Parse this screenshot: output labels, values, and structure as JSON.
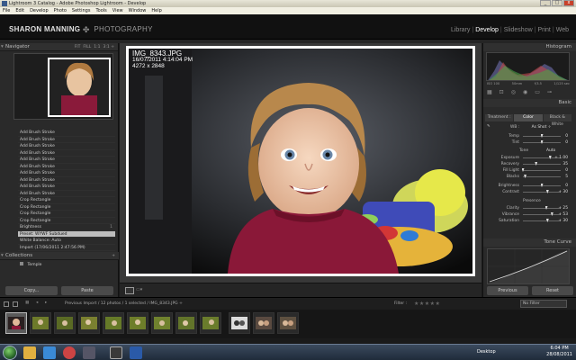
{
  "window": {
    "title": "Lightroom 3 Catalog - Adobe Photoshop Lightroom - Develop",
    "buttons": [
      "_",
      "□",
      "x"
    ]
  },
  "menu": [
    "File",
    "Edit",
    "Develop",
    "Photo",
    "Settings",
    "Tools",
    "View",
    "Window",
    "Help"
  ],
  "identity": {
    "first": "SHARON MANNING",
    "second": "PHOTOGRAPHY",
    "ornament": "✤"
  },
  "modules": {
    "items": [
      "Library",
      "Develop",
      "Slideshow",
      "Print",
      "Web"
    ],
    "separator": "|",
    "active": "Develop"
  },
  "left_panel": {
    "navigator": {
      "title": "Navigator",
      "options": [
        "FIT",
        "FILL",
        "1:1",
        "3:1 ÷"
      ]
    },
    "history": [
      "Add Brush Stroke",
      "Add Brush Stroke",
      "Add Brush Stroke",
      "Add Brush Stroke",
      "Add Brush Stroke",
      "Add Brush Stroke",
      "Add Brush Stroke",
      "Add Brush Stroke",
      "Add Brush Stroke",
      "Add Brush Stroke",
      "Crop Rectangle",
      "Crop Rectangle",
      "Crop Rectangle",
      "Crop Rectangle",
      "Brightness",
      "Preset: WYWF Subdued",
      "White Balance: Auto",
      "Import (17/06/2011 2:47:56 PM)"
    ],
    "history_selected_index": 15,
    "brightness_value": "1",
    "collections": {
      "title": "Collections",
      "add": "+",
      "item": "Temple"
    },
    "buttons": {
      "copy": "Copy...",
      "paste": "Paste"
    }
  },
  "photo": {
    "filename": "IMG_8343.JPG",
    "datetime": "16/07/2011 4:14:04 PM",
    "dimensions": "4272 x 2848"
  },
  "right_panel": {
    "histogram_title": "Histogram",
    "exif": [
      "ISO 100",
      "50mm",
      "f/3.5",
      "1/125 sec"
    ],
    "basic_title": "Basic",
    "treatment_tabs": [
      "Treatment :",
      "Color",
      "Black & White"
    ],
    "treatment_active": 1,
    "wb_label": "WB :",
    "wb_value": "As Shot ÷",
    "temp": {
      "label": "Temp",
      "value": "0",
      "pos": 0.5
    },
    "tint": {
      "label": "Tint",
      "value": "0",
      "pos": 0.5
    },
    "tone_label": "Tone",
    "tone_auto": "Auto",
    "exposure": {
      "label": "Exposure",
      "value": "+ 1.00",
      "pos": 0.72
    },
    "recovery": {
      "label": "Recovery",
      "value": "35",
      "pos": 0.35
    },
    "fill_light": {
      "label": "Fill Light",
      "value": "0",
      "pos": 0.0
    },
    "blacks": {
      "label": "Blacks",
      "value": "5",
      "pos": 0.06
    },
    "brightness": {
      "label": "Brightness",
      "value": "0",
      "pos": 0.5
    },
    "contrast": {
      "label": "Contrast",
      "value": "+ 30",
      "pos": 0.65
    },
    "presence_label": "Presence",
    "clarity": {
      "label": "Clarity",
      "value": "+ 25",
      "pos": 0.62
    },
    "vibrance": {
      "label": "Vibrance",
      "value": "+ 53",
      "pos": 0.77
    },
    "saturation": {
      "label": "Saturation",
      "value": "+ 30",
      "pos": 0.65
    },
    "tone_curve_title": "Tone Curve",
    "buttons": {
      "previous": "Previous",
      "reset": "Reset"
    }
  },
  "filmstrip_bar": {
    "breadcrumb": "Previous Import / 12 photos / 1 selected / IMG_8343.JPG ÷",
    "filter_label": "Filter :",
    "stars": "★★★★★",
    "filter_value": "No Filter"
  },
  "taskbar": {
    "desktop": "Desktop",
    "time": "6:04 PM",
    "date": "28/08/2011"
  }
}
